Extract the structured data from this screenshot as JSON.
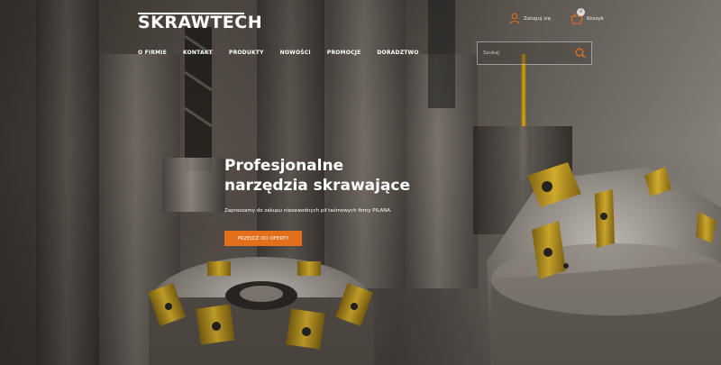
{
  "brand": {
    "name": "SKRAWTECH",
    "accent": "#e46f1b"
  },
  "header": {
    "login_label": "Zaloguj się",
    "cart_label": "Koszyk",
    "cart_count": "0",
    "icons": {
      "login": "user-icon",
      "cart": "basket-icon",
      "search": "search-icon"
    }
  },
  "nav": {
    "items": [
      {
        "label": "O FIRMIE"
      },
      {
        "label": "KONTAKT"
      },
      {
        "label": "PRODUKTY"
      },
      {
        "label": "NOWOŚCI"
      },
      {
        "label": "PROMOCJE"
      },
      {
        "label": "DORADZTWO"
      }
    ]
  },
  "search": {
    "placeholder": "Szukaj",
    "value": ""
  },
  "hero": {
    "title_line1": "Profesjonalne",
    "title_line2": "narzędzia skrawające",
    "subtitle": "Zapraszamy do zakupu niezawodnych pił taśmowych firmy PILANA.",
    "cta_label": "PRZEJDŹ DO OFERTY"
  }
}
